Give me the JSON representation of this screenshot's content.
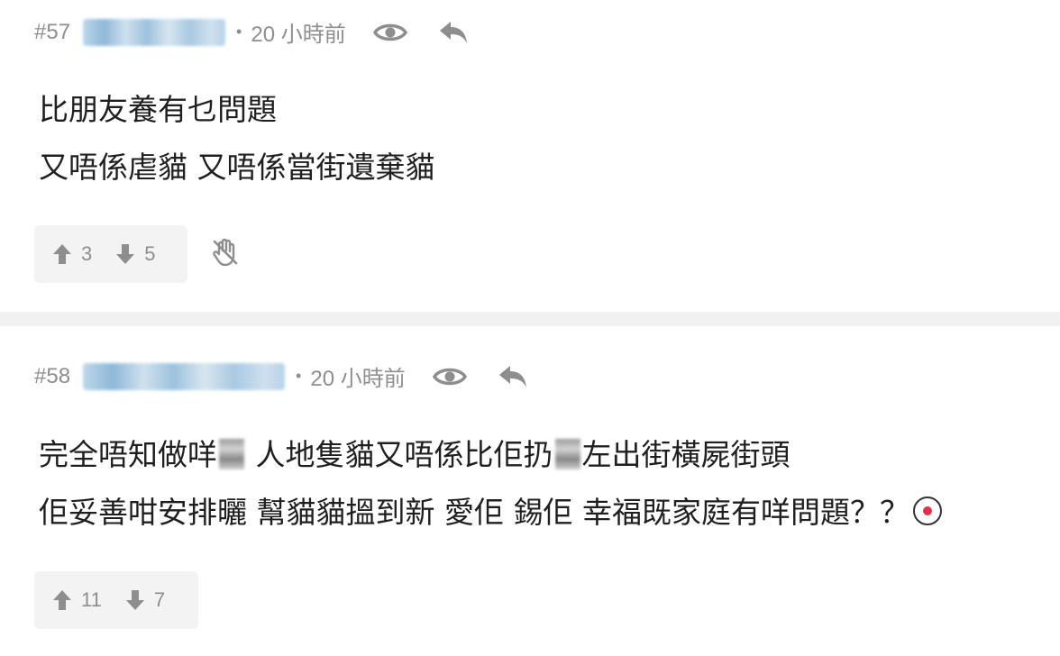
{
  "posts": [
    {
      "floor": "#57",
      "separator": "•",
      "time": "20 小時前",
      "lines": [
        "比朋友養有乜問題",
        "又唔係虐貓 又唔係當街遺棄貓"
      ],
      "upvotes": "3",
      "downvotes": "5"
    },
    {
      "floor": "#58",
      "separator": "•",
      "time": "20 小時前",
      "line1_a": "完全唔知做咩",
      "line1_b": " 人地隻貓又唔係比佢扔",
      "line1_c": "左出街橫屍街頭",
      "line2": "佢妥善咁安排曬 幫貓貓搵到新 愛佢 錫佢 幸福既家庭有咩問題？？",
      "upvotes": "11",
      "downvotes": "7"
    }
  ],
  "icons": {
    "view": "eye-icon",
    "reply": "reply-icon",
    "upvote": "arrow-up-icon",
    "downvote": "arrow-down-icon",
    "hide": "hand-slash-icon",
    "emoji": "emoji-icon"
  },
  "colors": {
    "meta_text": "#8e8e8e",
    "body_text": "#1f1f1f",
    "vote_bg": "#f3f3f3",
    "separator": "#f1f1f1"
  }
}
